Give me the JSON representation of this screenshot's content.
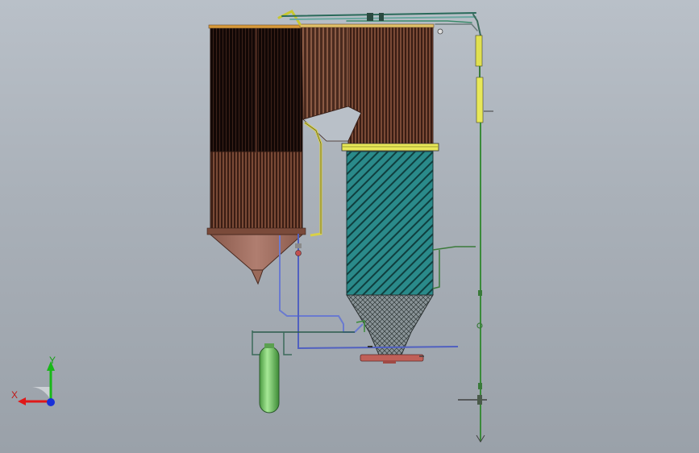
{
  "viewport": {
    "background_top": "#b9c0c8",
    "background_bottom": "#9aa1a9"
  },
  "triad": {
    "x_label": "X",
    "y_label": "Y",
    "x_color": "#e01818",
    "y_color": "#18b818",
    "z_color": "#1830d8"
  },
  "colors": {
    "tube_bank": "#6b3a2a",
    "tube_bank_dark": "#1a0d0a",
    "hopper_left": "#a87466",
    "furnace_tubes": "#1d8a8a",
    "header_yellow": "#f0f040",
    "pipe_green": "#3a8a3a",
    "pipe_blue": "#5060c0",
    "tank_green": "#7ad070",
    "base_red": "#c05a50"
  }
}
